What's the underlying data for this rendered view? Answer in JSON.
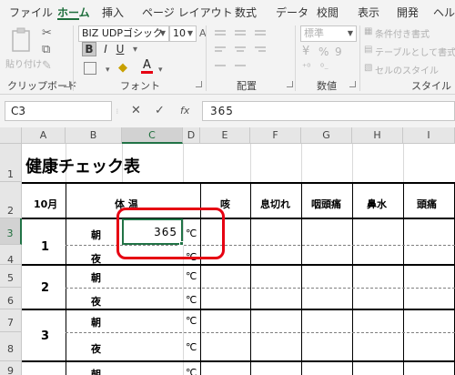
{
  "ribbon_tabs": [
    "ファイル",
    "ホーム",
    "挿入",
    "ページ レイアウト",
    "数式",
    "データ",
    "校閲",
    "表示",
    "開発",
    "ヘルプ"
  ],
  "ribbon": {
    "paste_label": "貼り付け",
    "clipboard_label": "クリップボード",
    "font_name": "BIZ UDPゴシック",
    "font_size": "10",
    "font_label": "フォント",
    "alignment_label": "配置",
    "number_format": "標準",
    "number_label": "数値",
    "conditional_format_label": "条件付き書式",
    "format_as_table_label": "テーブルとして書式設定",
    "cell_styles_label": "セルのスタイル",
    "styles_label": "スタイル",
    "bold_label": "B",
    "italic_label": "I",
    "underline_label": "U",
    "font_color_label": "A",
    "percent_label": "%",
    "comma_label": "9"
  },
  "formula_bar": {
    "name_box": "C3",
    "cancel_label": "✕",
    "enter_label": "✓",
    "fx_label": "fx",
    "content": "365"
  },
  "columns": [
    "A",
    "B",
    "C",
    "D",
    "E",
    "F",
    "G",
    "H",
    "I"
  ],
  "selected_column": "C",
  "rows": [
    "1",
    "2",
    "3",
    "4",
    "5",
    "6",
    "7",
    "8",
    "9"
  ],
  "selected_row": "3",
  "sheet": {
    "title": "健康チェック表",
    "header": {
      "month": "10月",
      "temperature": "体 温",
      "cough": "咳",
      "shortness_of_breath": "息切れ",
      "sore_throat": "咽頭痛",
      "runny_nose": "鼻水",
      "headache": "頭痛"
    },
    "days": [
      {
        "day": "1",
        "morning": "朝",
        "night": "夜",
        "morning_value": "365",
        "unit_morning": "℃",
        "unit_night": "℃"
      },
      {
        "day": "2",
        "morning": "朝",
        "night": "夜",
        "unit_morning": "℃",
        "unit_night": "℃"
      },
      {
        "day": "3",
        "morning": "朝",
        "night": "夜",
        "unit_morning": "℃",
        "unit_night": "℃"
      },
      {
        "morning": "朝",
        "unit_morning": "℃"
      }
    ]
  },
  "colors": {
    "accent": "#217346",
    "highlight": "#e60012"
  }
}
